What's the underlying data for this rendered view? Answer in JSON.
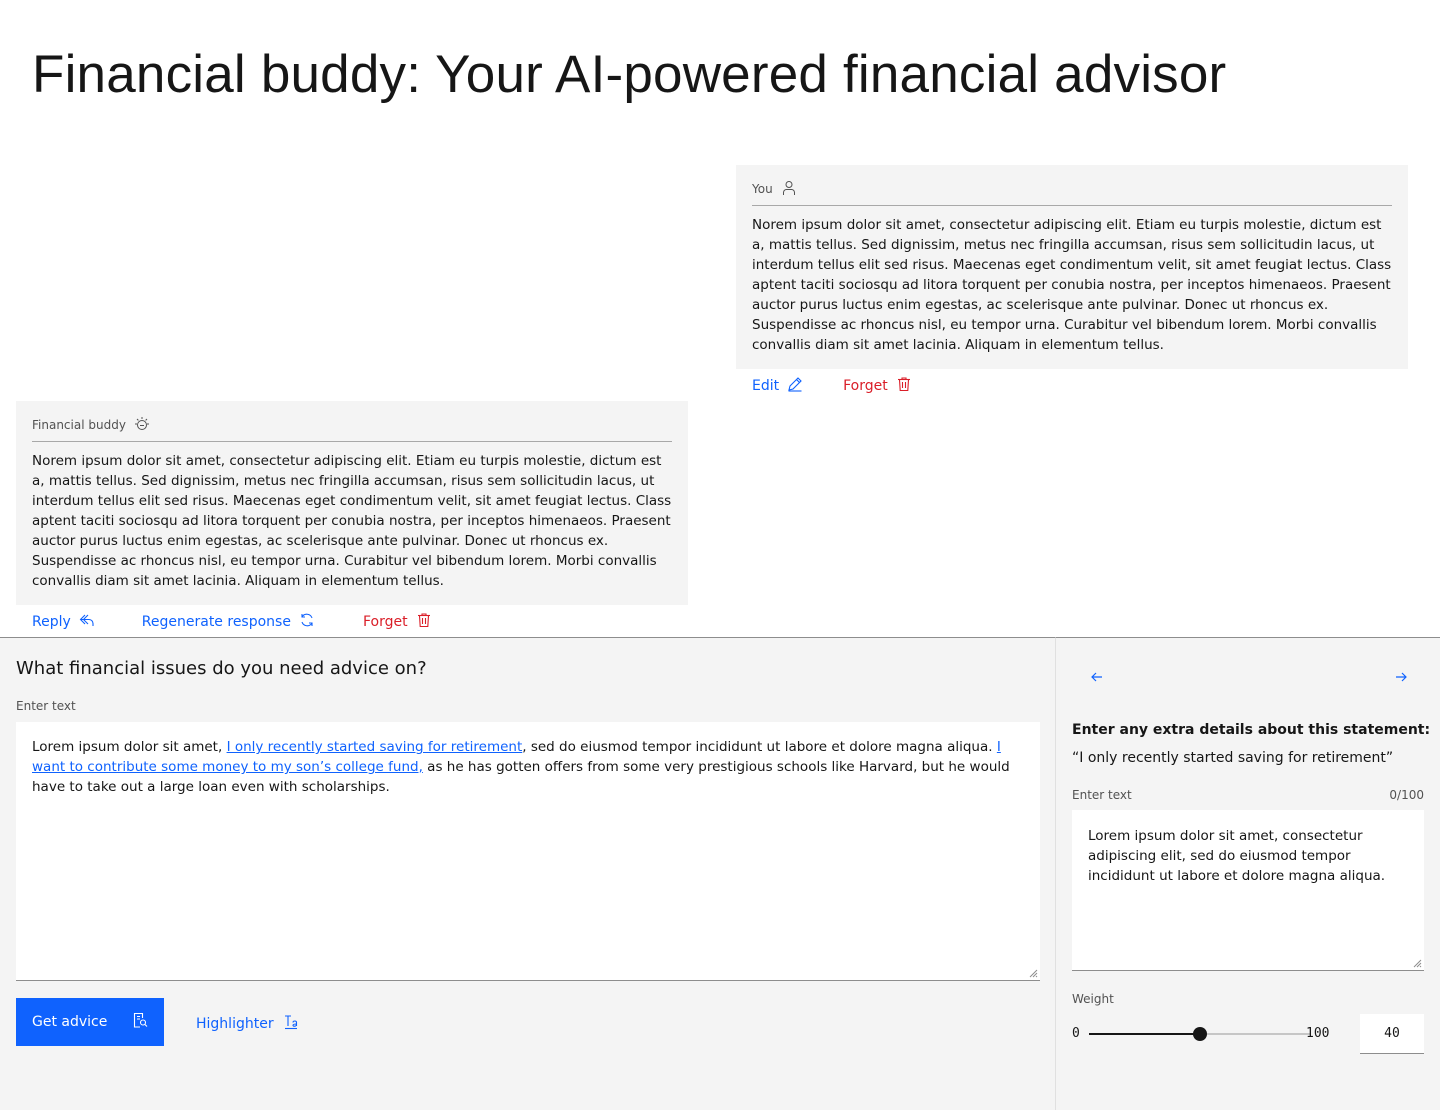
{
  "page": {
    "title": "Financial buddy: Your AI-powered financial advisor"
  },
  "user_message": {
    "author": "You",
    "author_icon": "user-icon",
    "text": "Norem ipsum dolor sit amet, consectetur adipiscing elit. Etiam eu turpis molestie, dictum est a, mattis tellus. Sed dignissim, metus nec fringilla accumsan, risus sem sollicitudin lacus, ut interdum tellus elit sed risus. Maecenas eget condimentum velit, sit amet feugiat lectus. Class aptent taciti sociosqu ad litora torquent per conubia nostra, per inceptos himenaeos. Praesent auctor purus luctus enim egestas, ac scelerisque ante pulvinar. Donec ut rhoncus ex. Suspendisse ac rhoncus nisl, eu tempor urna. Curabitur vel bibendum lorem. Morbi convallis convallis diam sit amet lacinia. Aliquam in elementum tellus.",
    "actions": {
      "edit": "Edit",
      "forget": "Forget"
    }
  },
  "bot_message": {
    "author": "Financial buddy",
    "author_icon": "watson-icon",
    "text": "Norem ipsum dolor sit amet, consectetur adipiscing elit. Etiam eu turpis molestie, dictum est a, mattis tellus. Sed dignissim, metus nec fringilla accumsan, risus sem sollicitudin lacus, ut interdum tellus elit sed risus. Maecenas eget condimentum velit, sit amet feugiat lectus. Class aptent taciti sociosqu ad litora torquent per conubia nostra, per inceptos himenaeos. Praesent auctor purus luctus enim egestas, ac scelerisque ante pulvinar. Donec ut rhoncus ex. Suspendisse ac rhoncus nisl, eu tempor urna. Curabitur vel bibendum lorem. Morbi convallis convallis diam sit amet lacinia. Aliquam in elementum tellus.",
    "actions": {
      "reply": "Reply",
      "regenerate": "Regenerate response",
      "forget": "Forget"
    }
  },
  "composer": {
    "question": "What financial issues do you need advice on?",
    "label": "Enter text",
    "text_parts": [
      "Lorem ipsum dolor sit amet, ",
      "I only recently started saving for retirement",
      ", sed do eiusmod tempor incididunt ut labore et dolore magna aliqua. ",
      "I want to contribute some money to my son’s college fund,",
      " as he has gotten offers from some very prestigious schools like Harvard, but he would have to take out a large loan even with scholarships."
    ],
    "primary_button": "Get advice",
    "ghost_button": "Highlighter"
  },
  "details_panel": {
    "title": "Enter any extra details about this statement:",
    "quote": "“I only recently started saving for retirement”",
    "label": "Enter text",
    "counter": "0/100",
    "text": "Lorem ipsum dolor sit amet, consectetur adipiscing elit, sed do eiusmod tempor incididunt ut labore et dolore magna aliqua.",
    "weight": {
      "label": "Weight",
      "min": "0",
      "max": "100",
      "value": "40",
      "value_num": 40,
      "max_num": 100
    }
  },
  "colors": {
    "accent": "#0f62fe",
    "danger": "#da1e28",
    "surface": "#f4f4f4"
  }
}
